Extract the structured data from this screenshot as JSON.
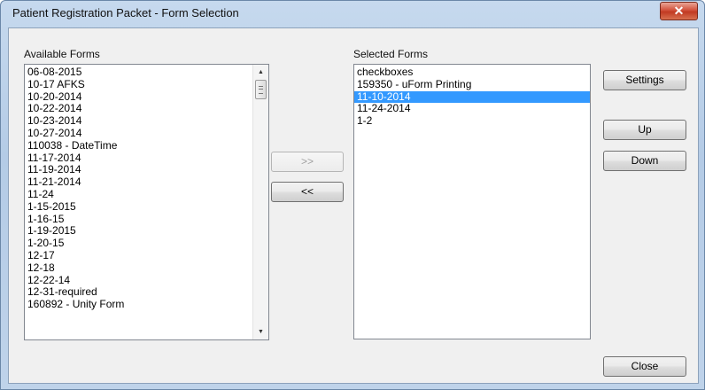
{
  "window": {
    "title": "Patient Registration Packet - Form Selection",
    "close_glyph": "✕"
  },
  "available": {
    "label": "Available Forms",
    "items": [
      "06-08-2015",
      "10-17 AFKS",
      "10-20-2014",
      "10-22-2014",
      "10-23-2014",
      "10-27-2014",
      "110038 - DateTime",
      "11-17-2014",
      "11-19-2014",
      "11-21-2014",
      "11-24",
      "1-15-2015",
      "1-16-15",
      "1-19-2015",
      "1-20-15",
      "12-17",
      "12-18",
      "12-22-14",
      "12-31-required",
      "160892 - Unity Form"
    ]
  },
  "selected": {
    "label": "Selected Forms",
    "items": [
      "checkboxes",
      "159350 - uForm Printing",
      "11-10-2014",
      "11-24-2014",
      "1-2"
    ],
    "selected_item": "11-10-2014"
  },
  "buttons": {
    "add": ">>",
    "remove": "<<",
    "settings": "Settings",
    "up": "Up",
    "down": "Down",
    "close": "Close"
  },
  "icons": {
    "scroll_up": "▲",
    "scroll_down": "▼"
  }
}
